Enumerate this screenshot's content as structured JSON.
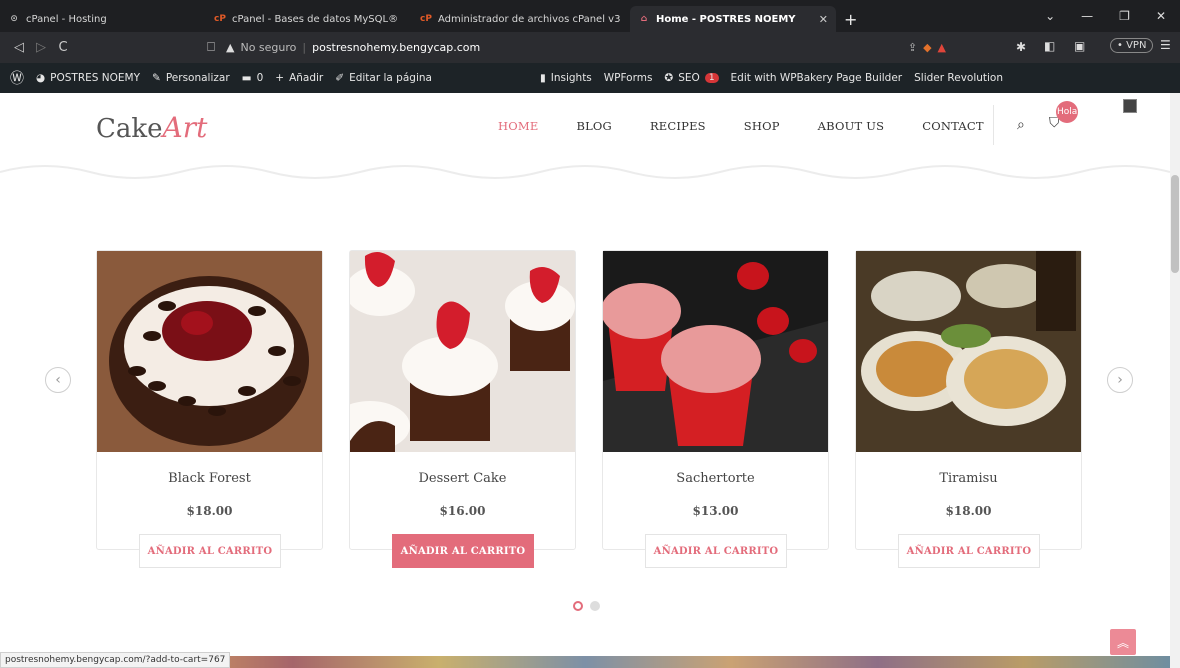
{
  "browser": {
    "tabs": [
      {
        "title": "cPanel - Hosting",
        "icon": "cpanel-hosting-icon"
      },
      {
        "title": "cPanel - Bases de datos MySQL®",
        "icon": "cpanel-icon"
      },
      {
        "title": "Administrador de archivos cPanel v3",
        "icon": "cpanel-icon"
      },
      {
        "title": "Home - POSTRES NOEMY",
        "icon": "site-icon",
        "active": true
      }
    ],
    "security": "No seguro",
    "url": "postresnohemy.bengycap.com",
    "vpn": "• VPN",
    "status_url": "postresnohemy.bengycap.com/?add-to-cart=767"
  },
  "wp_admin_bar": {
    "site_name": "POSTRES NOEMY",
    "customize": "Personalizar",
    "comments": "0",
    "add_new": "Añadir",
    "edit_page": "Editar la página",
    "insights": "Insights",
    "wpforms": "WPForms",
    "seo": "SEO",
    "seo_badge": "1",
    "wpbakery": "Edit with WPBakery Page Builder",
    "slider": "Slider Revolution",
    "greeting": "Hola, admin"
  },
  "site": {
    "logo_main": "Cake",
    "logo_accent": "Art",
    "nav": [
      "HOME",
      "BLOG",
      "RECIPES",
      "SHOP",
      "ABOUT US",
      "CONTACT"
    ],
    "active_nav": "HOME",
    "accent_color": "#e36c7b"
  },
  "products": [
    {
      "name": "Black Forest",
      "price": "$18.00",
      "button": "AÑADIR AL CARRITO"
    },
    {
      "name": "Dessert Cake",
      "price": "$16.00",
      "button": "AÑADIR AL CARRITO"
    },
    {
      "name": "Sachertorte",
      "price": "$13.00",
      "button": "AÑADIR AL CARRITO"
    },
    {
      "name": "Tiramisu",
      "price": "$18.00",
      "button": "AÑADIR AL CARRITO"
    }
  ],
  "carousel": {
    "pages": 2,
    "current": 1
  }
}
